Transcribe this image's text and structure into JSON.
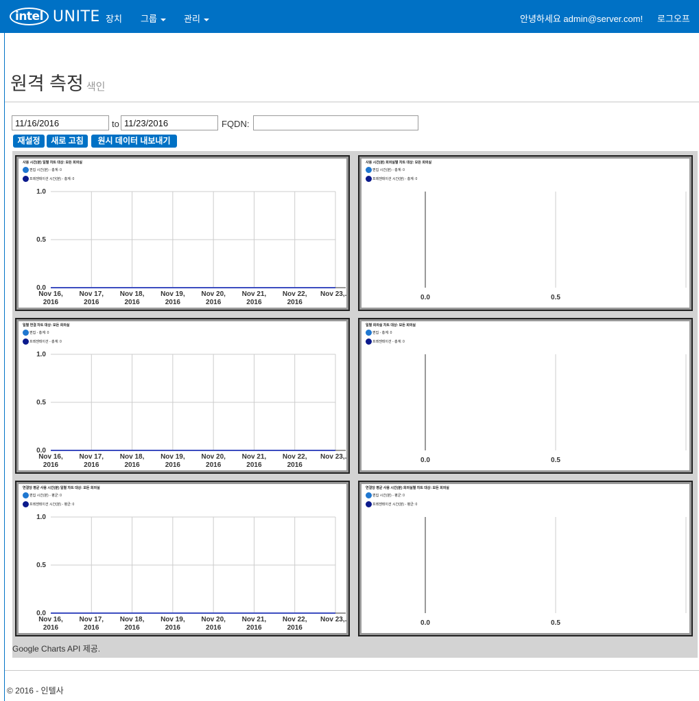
{
  "navbar": {
    "brand_intel": "intel",
    "brand_unite": "UNITE",
    "nav_devices": "장치",
    "nav_groups": "그룹",
    "nav_manage": "관리",
    "greeting": "안녕하세요 admin@server.com!",
    "logout": "로그오프"
  },
  "page": {
    "title": "원격 측정",
    "subtitle": "색인"
  },
  "filters": {
    "from_date": "11/16/2016",
    "to_label": "to",
    "to_date": "11/23/2016",
    "fqdn_label": "FQDN:",
    "fqdn_value": ""
  },
  "buttons": {
    "reset": "재설정",
    "refresh": "새로 고침",
    "export": "원시 데이터 내보내기"
  },
  "colors": {
    "brand_blue": "#0071c5",
    "series1": "#1f77d0",
    "series2": "#0b1a8c",
    "line": "#3b4cc0"
  },
  "chart_data": [
    {
      "type": "line",
      "title": "사용 시간(분) 일별 차트 대상: 모든 회의실",
      "x": [
        "Nov 16, 2016",
        "Nov 17, 2016",
        "Nov 18, 2016",
        "Nov 19, 2016",
        "Nov 20, 2016",
        "Nov 21, 2016",
        "Nov 22, 2016",
        "Nov 23,..."
      ],
      "series": [
        {
          "name": "편집 시간(분) - 총계: 0",
          "values": [
            0,
            0,
            0,
            0,
            0,
            0,
            0,
            0
          ]
        },
        {
          "name": "프레젠테이션 시간(분) - 총계: 0",
          "values": [
            0,
            0,
            0,
            0,
            0,
            0,
            0,
            0
          ]
        }
      ],
      "y_ticks": [
        "0.0",
        "0.5",
        "1.0"
      ],
      "ylim": [
        0,
        1
      ],
      "grid": true
    },
    {
      "type": "bar",
      "title": "사용 시간(분) 회의실별 차트 대상: 모든 회의실",
      "series": [
        {
          "name": "편집 시간(분) - 총계: 0",
          "values": []
        },
        {
          "name": "프레젠테이션 시간(분) - 총계: 0",
          "values": []
        }
      ],
      "x_ticks": [
        "0.0",
        "0.5"
      ],
      "xlim": [
        0,
        1
      ],
      "grid": true
    },
    {
      "type": "line",
      "title": "일별 연결 차트 대상: 모든 회의실",
      "x": [
        "Nov 16, 2016",
        "Nov 17, 2016",
        "Nov 18, 2016",
        "Nov 19, 2016",
        "Nov 20, 2016",
        "Nov 21, 2016",
        "Nov 22, 2016",
        "Nov 23,..."
      ],
      "series": [
        {
          "name": "편집 - 총계: 0",
          "values": [
            0,
            0,
            0,
            0,
            0,
            0,
            0,
            0
          ]
        },
        {
          "name": "프레젠테이션 - 총계: 0",
          "values": [
            0,
            0,
            0,
            0,
            0,
            0,
            0,
            0
          ]
        }
      ],
      "y_ticks": [
        "0.0",
        "0.5",
        "1.0"
      ],
      "ylim": [
        0,
        1
      ],
      "grid": true
    },
    {
      "type": "bar",
      "title": "일별 회의실 차트 대상: 모든 회의실",
      "series": [
        {
          "name": "편집 - 총계: 0",
          "values": []
        },
        {
          "name": "프레젠테이션 - 총계: 0",
          "values": []
        }
      ],
      "x_ticks": [
        "0.0",
        "0.5"
      ],
      "xlim": [
        0,
        1
      ],
      "grid": true
    },
    {
      "type": "line",
      "title": "연결당 평균 사용 시간(분) 일별 차트 대상: 모든 회의실",
      "x": [
        "Nov 16, 2016",
        "Nov 17, 2016",
        "Nov 18, 2016",
        "Nov 19, 2016",
        "Nov 20, 2016",
        "Nov 21, 2016",
        "Nov 22, 2016",
        "Nov 23,..."
      ],
      "series": [
        {
          "name": "편집 시간(분) - 평균: 0",
          "values": [
            0,
            0,
            0,
            0,
            0,
            0,
            0,
            0
          ]
        },
        {
          "name": "프레젠테이션 시간(분) - 평균: 0",
          "values": [
            0,
            0,
            0,
            0,
            0,
            0,
            0,
            0
          ]
        }
      ],
      "y_ticks": [
        "0.0",
        "0.5",
        "1.0"
      ],
      "ylim": [
        0,
        1
      ],
      "grid": true
    },
    {
      "type": "bar",
      "title": "연결당 평균 사용 시간(분) 회의실별 차트 대상: 모든 회의실",
      "series": [
        {
          "name": "편집 시간(분) - 평균: 0",
          "values": []
        },
        {
          "name": "프레젠테이션 시간(분) - 평균: 0",
          "values": []
        }
      ],
      "x_ticks": [
        "0.0",
        "0.5"
      ],
      "xlim": [
        0,
        1
      ],
      "grid": true
    }
  ],
  "credit": "Google Charts API 제공.",
  "footer": "© 2016 - 인텔사"
}
